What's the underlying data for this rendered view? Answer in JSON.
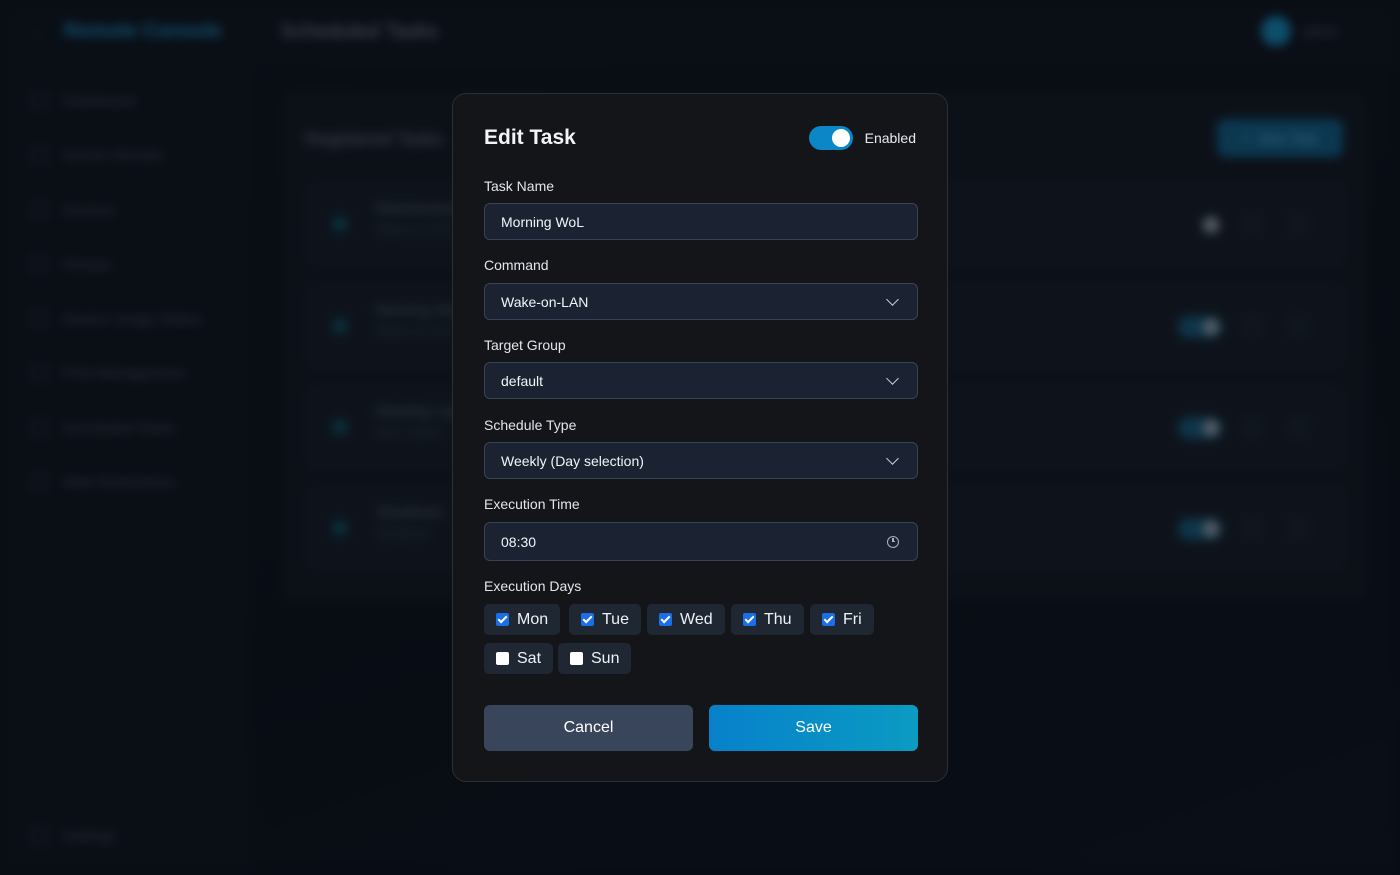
{
  "app": {
    "brand": "Remote Console",
    "page_title": "Scheduled Tasks",
    "user": "admin"
  },
  "sidebar": {
    "items": [
      {
        "label": "Dashboard"
      },
      {
        "label": "Screen Monitor"
      },
      {
        "label": "Devices"
      },
      {
        "label": "Groups"
      },
      {
        "label": "Device Usage Status"
      },
      {
        "label": "Print Management"
      },
      {
        "label": "Scheduled Tasks"
      },
      {
        "label": "Web Restrictions"
      }
    ],
    "settings": "Settings"
  },
  "tasks_panel": {
    "title": "Registered Tasks",
    "new_button": "New Task",
    "rows": [
      {
        "name": "Maintenance",
        "detail": "Wake-on-LAN",
        "enabled": false
      },
      {
        "name": "Morning WoL",
        "detail": "Wake-on-LAN",
        "enabled": true
      },
      {
        "name": "Meeting Logout",
        "detail": "Auto Logout",
        "enabled": true
      },
      {
        "name": "Shutdown",
        "detail": "Shutdown",
        "enabled": true
      }
    ]
  },
  "modal": {
    "title": "Edit Task",
    "enabled_label": "Enabled",
    "enabled": true,
    "task_name": {
      "label": "Task Name",
      "value": "Morning WoL"
    },
    "command": {
      "label": "Command",
      "value": "Wake-on-LAN"
    },
    "target_group": {
      "label": "Target Group",
      "value": "default"
    },
    "schedule_type": {
      "label": "Schedule Type",
      "value": "Weekly (Day selection)"
    },
    "execution_time": {
      "label": "Execution Time",
      "value": "08:30"
    },
    "execution_days": {
      "label": "Execution Days",
      "days": [
        {
          "label": "Mon",
          "checked": true
        },
        {
          "label": "Tue",
          "checked": true
        },
        {
          "label": "Wed",
          "checked": true
        },
        {
          "label": "Thu",
          "checked": true
        },
        {
          "label": "Fri",
          "checked": true
        },
        {
          "label": "Sat",
          "checked": false
        },
        {
          "label": "Sun",
          "checked": false
        }
      ]
    },
    "cancel_label": "Cancel",
    "save_label": "Save"
  },
  "colors": {
    "accent": "#0b86c6",
    "checkbox": "#1a6ee8",
    "cancel_bg": "#39455a",
    "modal_bg": "#131519"
  }
}
